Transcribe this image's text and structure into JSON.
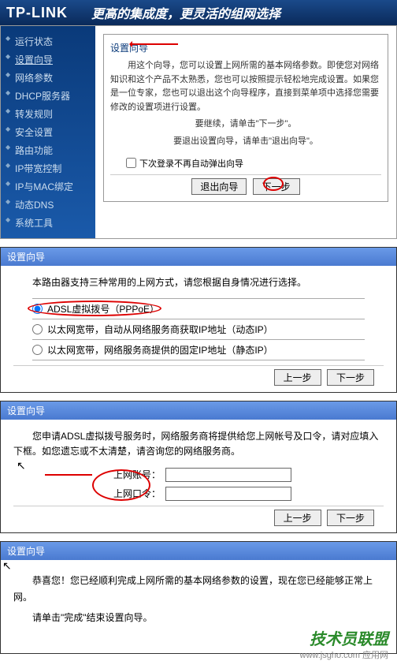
{
  "header": {
    "logo": "TP-LINK",
    "slogan": "更高的集成度，更灵活的组网选择"
  },
  "sidebar": {
    "items": [
      {
        "label": "运行状态"
      },
      {
        "label": "设置向导"
      },
      {
        "label": "网络参数"
      },
      {
        "label": "DHCP服务器"
      },
      {
        "label": "转发规则"
      },
      {
        "label": "安全设置"
      },
      {
        "label": "路由功能"
      },
      {
        "label": "IP带宽控制"
      },
      {
        "label": "IP与MAC绑定"
      },
      {
        "label": "动态DNS"
      },
      {
        "label": "系统工具"
      }
    ]
  },
  "wizard1": {
    "title": "设置向导",
    "text": "用这个向导，您可以设置上网所需的基本网络参数。即使您对网络知识和这个产品不太熟悉，您也可以按照提示轻松地完成设置。如果您是一位专家，您也可以退出这个向导程序，直接到菜单项中选择您需要修改的设置项进行设置。",
    "continue_text": "要继续，请单击\"下一步\"。",
    "exit_text": "要退出设置向导，请单击\"退出向导\"。",
    "checkbox_label": "下次登录不再自动弹出向导",
    "exit_btn": "退出向导",
    "next_btn": "下一步"
  },
  "wizard2": {
    "header": "设置向导",
    "intro": "本路由器支持三种常用的上网方式，请您根据自身情况进行选择。",
    "options": [
      {
        "label": "ADSL虚拟拨号（PPPoE）"
      },
      {
        "label": "以太网宽带，自动从网络服务商获取IP地址（动态IP）"
      },
      {
        "label": "以太网宽带，网络服务商提供的固定IP地址（静态IP）"
      }
    ],
    "prev_btn": "上一步",
    "next_btn": "下一步"
  },
  "wizard3": {
    "header": "设置向导",
    "intro": "您申请ADSL虚拟拨号服务时，网络服务商将提供给您上网帐号及口令，请对应填入下框。如您遗忘或不太清楚，请咨询您的网络服务商。",
    "account_label": "上网账号：",
    "password_label": "上网口令：",
    "account_value": "",
    "password_value": "",
    "prev_btn": "上一步",
    "next_btn": "下一步"
  },
  "wizard4": {
    "header": "设置向导",
    "text1": "恭喜您！您已经顺利完成上网所需的基本网络参数的设置，现在您已经能够正常上网。",
    "text2": "请单击\"完成\"结束设置向导。"
  },
  "watermark": {
    "text": "技术员联盟",
    "url": "www.jsgho.com",
    "small": "应用网"
  }
}
